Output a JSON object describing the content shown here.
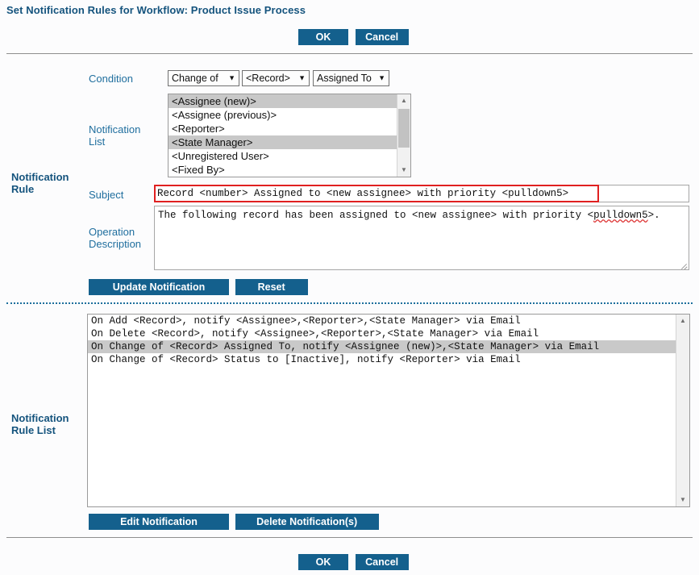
{
  "page": {
    "title": "Set Notification Rules for Workflow: Product Issue Process",
    "accent_color": "#14608d",
    "label_color": "#1f6e9e",
    "annotation_color": "#e02020",
    "background": "#fcfcfd"
  },
  "top_actions": {
    "ok_label": "OK",
    "cancel_label": "Cancel"
  },
  "bottom_actions": {
    "ok_label": "OK",
    "cancel_label": "Cancel"
  },
  "notification_rule": {
    "section_label": "Notification Rule",
    "condition": {
      "label": "Condition",
      "selects": [
        {
          "name": "condition-type",
          "value": "Change of",
          "caret": "chevron-down-icon"
        },
        {
          "name": "condition-object",
          "value": "<Record>",
          "caret": "chevron-down-icon"
        },
        {
          "name": "condition-field",
          "value": "Assigned To",
          "caret": "chevron-down-icon"
        }
      ]
    },
    "notification_list": {
      "label_line1": "Notification",
      "label_line2": "List",
      "options": [
        {
          "text": "<Assignee (new)>",
          "selected": true
        },
        {
          "text": "<Assignee (previous)>",
          "selected": false
        },
        {
          "text": "<Reporter>",
          "selected": false
        },
        {
          "text": "<State Manager>",
          "selected": true
        },
        {
          "text": "<Unregistered User>",
          "selected": false
        },
        {
          "text": "<Fixed By>",
          "selected": false
        }
      ],
      "scroll_up_icon": "triangle-up-icon",
      "scroll_down_icon": "triangle-down-icon"
    },
    "subject": {
      "label": "Subject",
      "value": "Record <number> Assigned to <new assignee> with priority <pulldown5>",
      "placeholder": "",
      "highlighted": true
    },
    "operation_description": {
      "label_line1": "Operation",
      "label_line2": "Description",
      "value_before": "The following record has been assigned to <new assignee> with priority <",
      "value_spell": "pulldown5",
      "value_after": ">."
    },
    "buttons": {
      "update_label": "Update Notification",
      "reset_label": "Reset"
    }
  },
  "notification_rule_list": {
    "section_label_line1": "Notification",
    "section_label_line2": "Rule List",
    "rows": [
      {
        "text": "On Add <Record>, notify <Assignee>,<Reporter>,<State Manager> via Email",
        "selected": false
      },
      {
        "text": "On Delete <Record>, notify <Assignee>,<Reporter>,<State Manager> via Email",
        "selected": false
      },
      {
        "text": "On Change of <Record> Assigned To, notify <Assignee (new)>,<State Manager> via Email",
        "selected": true
      },
      {
        "text": "On Change of <Record> Status to [Inactive], notify <Reporter> via Email",
        "selected": false
      }
    ],
    "scroll_up_icon": "triangle-up-icon",
    "scroll_down_icon": "triangle-down-icon",
    "buttons": {
      "edit_label": "Edit Notification",
      "delete_label": "Delete Notification(s)"
    }
  }
}
